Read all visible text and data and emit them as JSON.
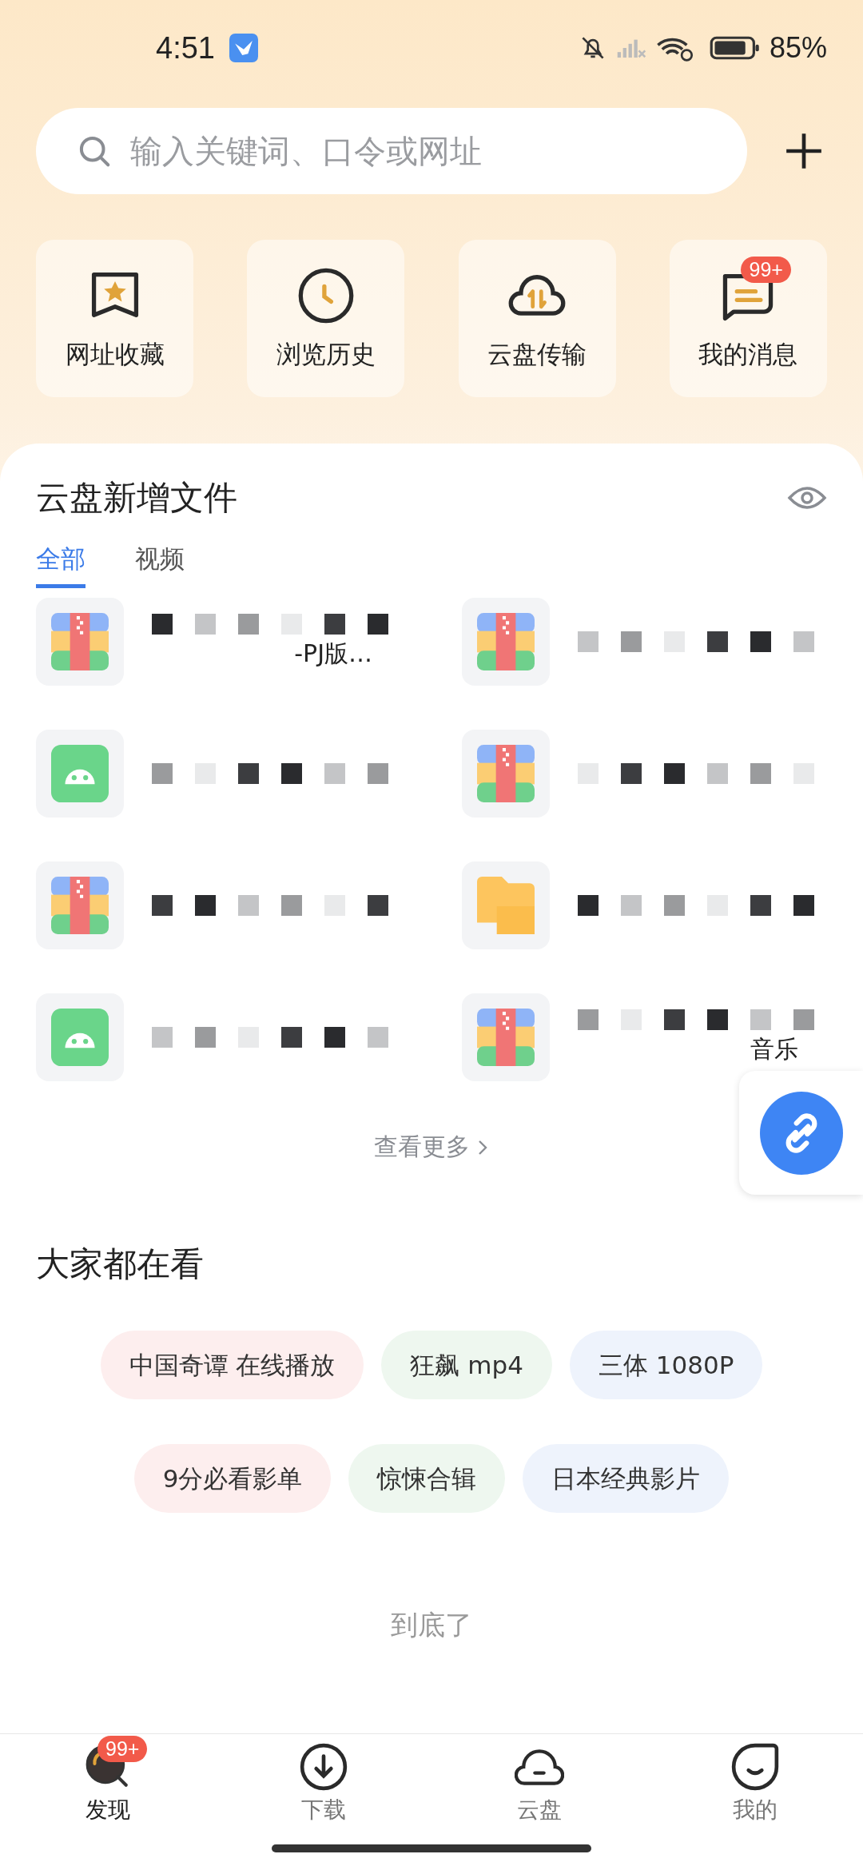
{
  "status_bar": {
    "time": "4:51",
    "battery_text": "85%"
  },
  "search": {
    "placeholder": "输入关键词、口令或网址"
  },
  "shortcuts": [
    {
      "label": "网址收藏",
      "kind": "bookmark"
    },
    {
      "label": "浏览历史",
      "kind": "history"
    },
    {
      "label": "云盘传输",
      "kind": "transfer"
    },
    {
      "label": "我的消息",
      "kind": "message",
      "badge": "99+"
    }
  ],
  "cloud_section": {
    "title": "云盘新增文件",
    "tabs": [
      {
        "label": "全部",
        "selected": true
      },
      {
        "label": "视频",
        "selected": false
      }
    ],
    "files": [
      {
        "kind": "zip",
        "visible_text": "-PJ版…"
      },
      {
        "kind": "zip"
      },
      {
        "kind": "apk"
      },
      {
        "kind": "zip"
      },
      {
        "kind": "zip"
      },
      {
        "kind": "folder"
      },
      {
        "kind": "apk"
      },
      {
        "kind": "zip",
        "visible_text": "音乐"
      }
    ],
    "more": "查看更多"
  },
  "trending": {
    "title": "大家都在看",
    "rows": [
      [
        {
          "label": "中国奇谭 在线播放",
          "color": "#fdeeee"
        },
        {
          "label": "狂飙 mp4",
          "color": "#eef7ef"
        },
        {
          "label": "三体 1080P",
          "color": "#eef3fc"
        }
      ],
      [
        {
          "label": "9分必看影单",
          "color": "#fdeeee"
        },
        {
          "label": "惊悚合辑",
          "color": "#eef7ef"
        },
        {
          "label": "日本经典影片",
          "color": "#eef3fc"
        }
      ]
    ]
  },
  "end_text": "到底了",
  "nav": [
    {
      "label": "发现",
      "kind": "discover",
      "selected": true,
      "badge": "99+"
    },
    {
      "label": "下载",
      "kind": "download",
      "selected": false
    },
    {
      "label": "云盘",
      "kind": "cloud",
      "selected": false
    },
    {
      "label": "我的",
      "kind": "me",
      "selected": false
    }
  ]
}
